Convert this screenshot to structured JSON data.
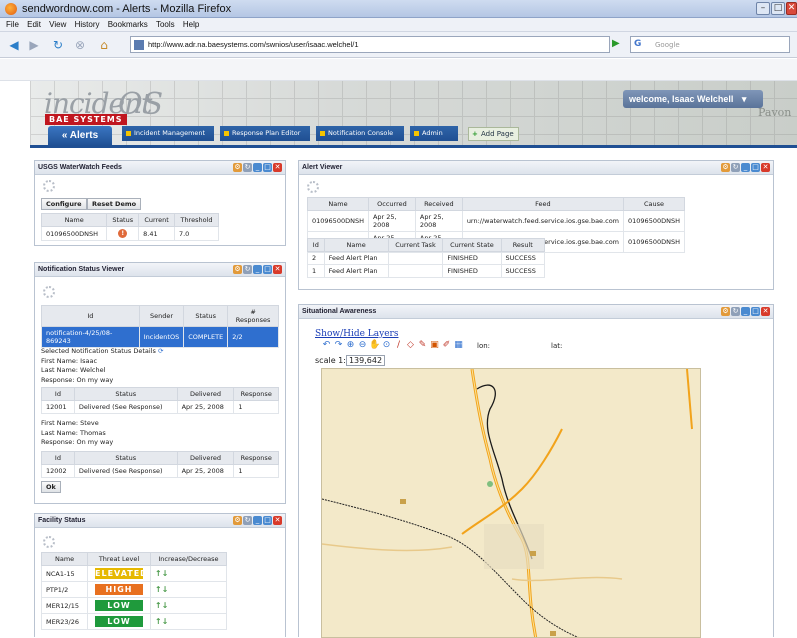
{
  "browser": {
    "window_title": "sendwordnow.com - Alerts - Mozilla Firefox",
    "menu": [
      "File",
      "Edit",
      "View",
      "History",
      "Bookmarks",
      "Tools",
      "Help"
    ],
    "url": "http://www.adr.na.baesystems.com/swnios/user/isaac.welchel/1",
    "search_placeholder": "Google"
  },
  "app": {
    "logo_text_1": "incident",
    "logo_text_2": "OS",
    "brand_badge": "BAE SYSTEMS",
    "welcome": "welcome, Isaac Welchell",
    "map_bg_label": "Pavon"
  },
  "tabs": {
    "active": "Alerts",
    "items": [
      "Incident Management",
      "Response Plan Editor",
      "Notification Console",
      "Admin"
    ],
    "add_page": "Add Page"
  },
  "usgs": {
    "title": "USGS WaterWatch Feeds",
    "configure": "Configure",
    "reset_demo": "Reset Demo",
    "headers": [
      "Name",
      "Status",
      "Current",
      "Threshold"
    ],
    "row": {
      "name": "01096500DNSH",
      "status": "!",
      "current": "8.41",
      "threshold": "7.0"
    }
  },
  "notif": {
    "title": "Notification Status Viewer",
    "headers": [
      "Id",
      "Sender",
      "Status",
      "# Responses"
    ],
    "row": {
      "id": "notification-4/25/08-869243",
      "sender": "IncidentOS",
      "status": "COMPLETE",
      "responses": "2/2"
    },
    "selected_label": "Selected Notification Status Details",
    "person1": {
      "first": "First Name: Isaac",
      "last": "Last Name: Welchel",
      "response": "Response: On my way"
    },
    "person2": {
      "first": "First Name: Steve",
      "last": "Last Name: Thomas",
      "response": "Response: On my way"
    },
    "sub_headers": [
      "Id",
      "Status",
      "Delivered",
      "Response"
    ],
    "sub_row1": {
      "id": "12001",
      "status": "Delivered (See Response)",
      "delivered": "Apr 25, 2008",
      "response": "1"
    },
    "sub_row2": {
      "id": "12002",
      "status": "Delivered (See Response)",
      "delivered": "Apr 25, 2008",
      "response": "1"
    },
    "ok": "Ok"
  },
  "facility": {
    "title": "Facility Status",
    "headers": [
      "Name",
      "Threat Level",
      "Increase/Decrease"
    ],
    "rows": [
      {
        "name": "NCA1-15",
        "level": "ELEVATED",
        "color": "#e6b800"
      },
      {
        "name": "PTP1/2",
        "level": "HIGH",
        "color": "#e8701f"
      },
      {
        "name": "MER12/15",
        "level": "LOW",
        "color": "#1f9a3c"
      },
      {
        "name": "MER23/26",
        "level": "LOW",
        "color": "#1f9a3c"
      }
    ]
  },
  "alerts": {
    "title": "Alert Viewer",
    "headers": [
      "Name",
      "Occurred",
      "Received",
      "Feed",
      "Cause"
    ],
    "rows": [
      {
        "name": "01096500DNSH",
        "occurred": "Apr 25, 2008",
        "received": "Apr 25, 2008",
        "feed": "urn://waterwatch.feed.service.ios.gse.bae.com",
        "cause": "01096500DNSH"
      },
      {
        "name": "01096500DNSH",
        "occurred": "Apr 25, 2008",
        "received": "Apr 25, 2008",
        "feed": "urn://waterwatch.feed.service.ios.gse.bae.com",
        "cause": "01096500DNSH"
      }
    ],
    "plan_headers": [
      "Id",
      "Name",
      "Current Task",
      "Current State",
      "Result"
    ],
    "plan_rows": [
      {
        "id": "2",
        "name": "Feed Alert Plan",
        "task": "",
        "state": "FINISHED",
        "result": "SUCCESS"
      },
      {
        "id": "1",
        "name": "Feed Alert Plan",
        "task": "",
        "state": "FINISHED",
        "result": "SUCCESS"
      }
    ]
  },
  "situational": {
    "title": "Situational Awareness",
    "layers_link": "Show/Hide Layers",
    "lon_label": "lon:",
    "lat_label": "lat:",
    "scale_label": "scale 1:",
    "scale_value": "139,642"
  }
}
